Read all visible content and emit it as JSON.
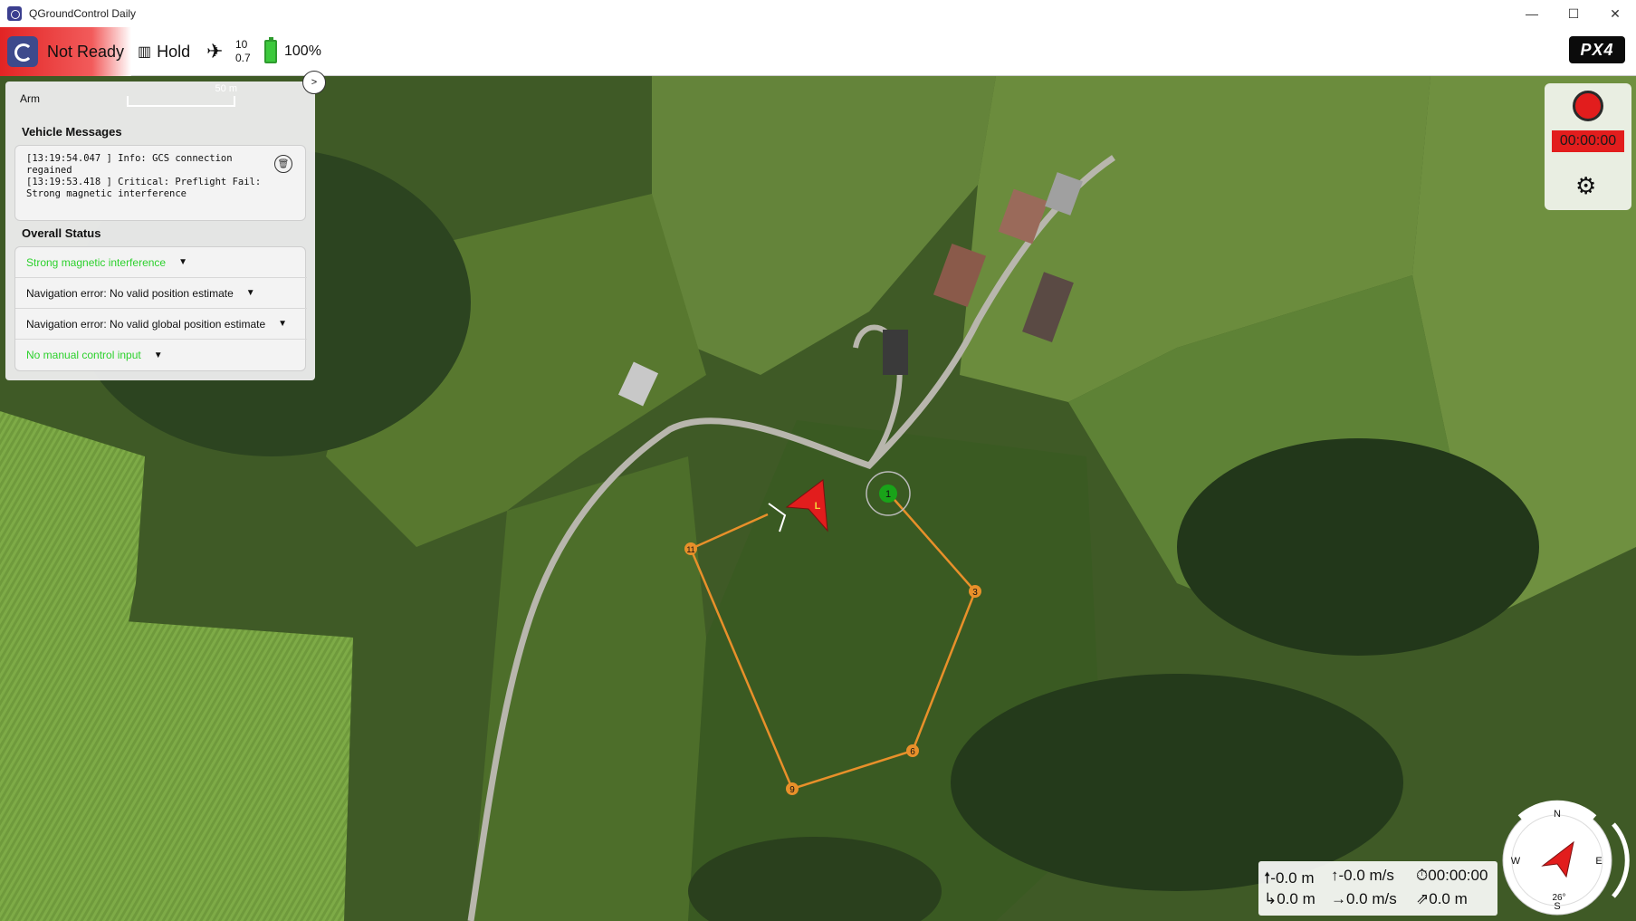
{
  "window": {
    "title": "QGroundControl Daily",
    "controls": [
      "—",
      "☐",
      "✕"
    ]
  },
  "toolbar": {
    "ready_status": "Not Ready",
    "flight_mode": "Hold",
    "gps_sat_count": "10",
    "gps_hdop": "0.7",
    "battery": "100%",
    "brand_logo": "PX4"
  },
  "panel": {
    "arm_label": "Arm",
    "scale_label": "50 m",
    "collapse_label": ">",
    "vehicle_messages_title": "Vehicle Messages",
    "messages": "[13:19:54.047 ] Info: GCS connection\nregained\n[13:19:53.418 ] Critical: Preflight Fail:\nStrong magnetic interference",
    "overall_status_title": "Overall Status",
    "status_items": [
      {
        "text": "Strong magnetic interference",
        "color": "#2dd12d"
      },
      {
        "text": "Navigation error: No valid position estimate",
        "color": "#111111"
      },
      {
        "text": "Navigation error: No valid global position estimate",
        "color": "#111111"
      },
      {
        "text": "No manual control input",
        "color": "#2dd12d"
      }
    ]
  },
  "recorder": {
    "time": "00:00:00"
  },
  "mission": {
    "waypoints": [
      "1",
      "3",
      "6",
      "9",
      "11"
    ],
    "vehicle_label": "L"
  },
  "telemetry": {
    "altitude": "-0.0 m",
    "vertical_speed": "-0.0 m/s",
    "flight_time": "00:00:00",
    "distance_home": "0.0 m",
    "ground_speed": "0.0 m/s",
    "distance_wp": "0.0 m"
  },
  "compass": {
    "north": "N",
    "east": "E",
    "south": "S",
    "west": "W",
    "heading": "26°"
  },
  "colors": {
    "not_ready_red": "#e22424",
    "status_green": "#2dd12d",
    "mission_line": "#e8902a",
    "vehicle_red": "#e21d1d"
  }
}
